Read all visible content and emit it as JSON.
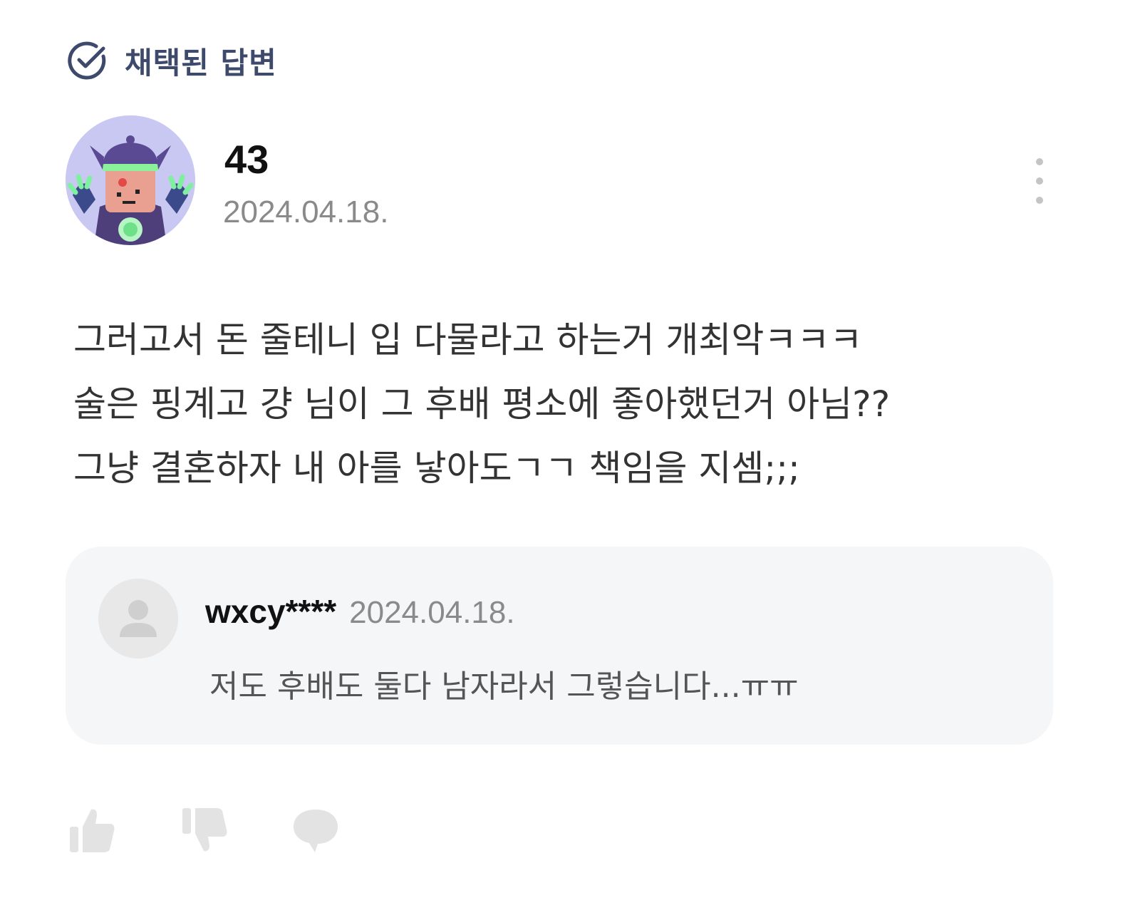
{
  "header": {
    "adopted_label": "채택된 답변",
    "icon": "check-circle-icon"
  },
  "answer": {
    "author": "43",
    "date": "2024.04.18.",
    "lines": [
      "그러고서 돈 줄테니 입 다물라고 하는거 개최악ㅋㅋㅋ",
      "술은 핑계고 걍 님이 그 후배 평소에 좋아했던거 아님??",
      "그냥 결혼하자 내 아를 낳아도ㄱㄱ 책임을 지셈;;;"
    ],
    "more_icon": "more-vertical-icon"
  },
  "comment": {
    "user": "wxcy****",
    "date": "2024.04.18.",
    "text": "저도 후배도 둘다 남자라서 그렇습니다...ㅠㅠ",
    "avatar_icon": "default-user-icon"
  },
  "actions": {
    "like_icon": "thumbs-up-icon",
    "dislike_icon": "thumbs-down-icon",
    "comment_icon": "speech-bubble-icon"
  },
  "colors": {
    "header_accent": "#3d4a6b",
    "text": "#333333",
    "muted": "#8a8a8a",
    "card_bg": "#f5f6f8",
    "icon_gray": "#e3e3e3"
  }
}
